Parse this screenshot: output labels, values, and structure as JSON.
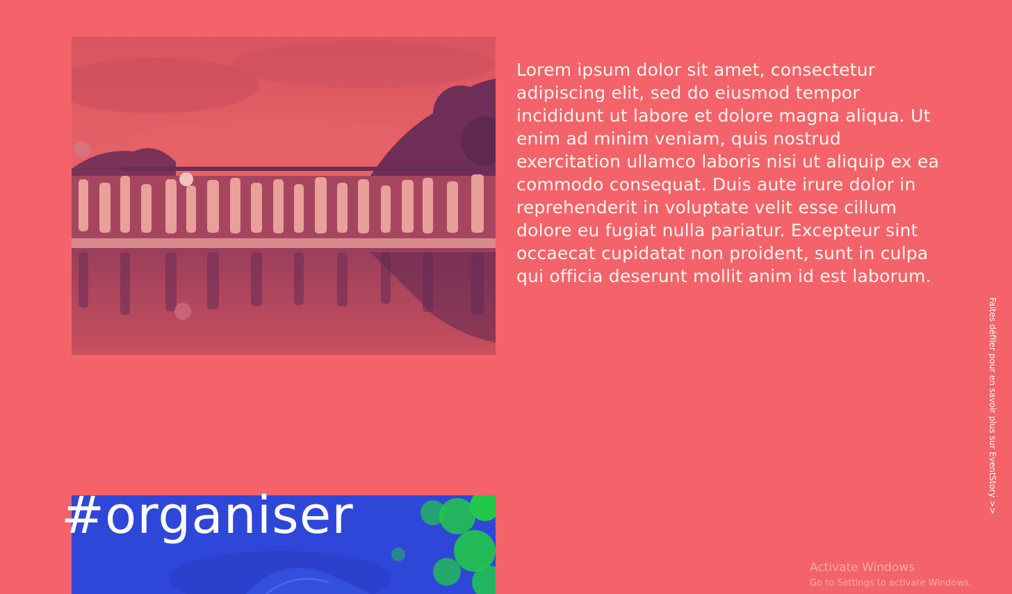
{
  "intro": {
    "paragraph": "Lorem ipsum dolor sit amet, consectetur adipiscing elit, sed do eiusmod tempor incididunt ut labore et dolore magna aliqua. Ut enim ad minim veniam, quis nostrud exercitation ullamco laboris nisi ut aliquip ex ea commodo consequat. Duis aute irure dolor in reprehenderit in voluptate velit esse cillum dolore eu fugiat nulla pariatur. Excepteur sint occaecat cupidatat non proident, sunt in culpa qui officia deserunt mollit anim id est laborum."
  },
  "scroll_hint": {
    "label": "Faites défiler pour en savoir plus sur EventStory >>"
  },
  "organiser": {
    "heading": "#organiser"
  },
  "system_watermark": {
    "title": "Activate Windows",
    "subtitle": "Go to Settings to activate Windows."
  },
  "colors": {
    "background": "#f4636a",
    "text": "#fff4ef",
    "photo_tint_dark": "#6e2e57",
    "organiser_blue": "#2f47d8",
    "organiser_green": "#22c84a"
  }
}
